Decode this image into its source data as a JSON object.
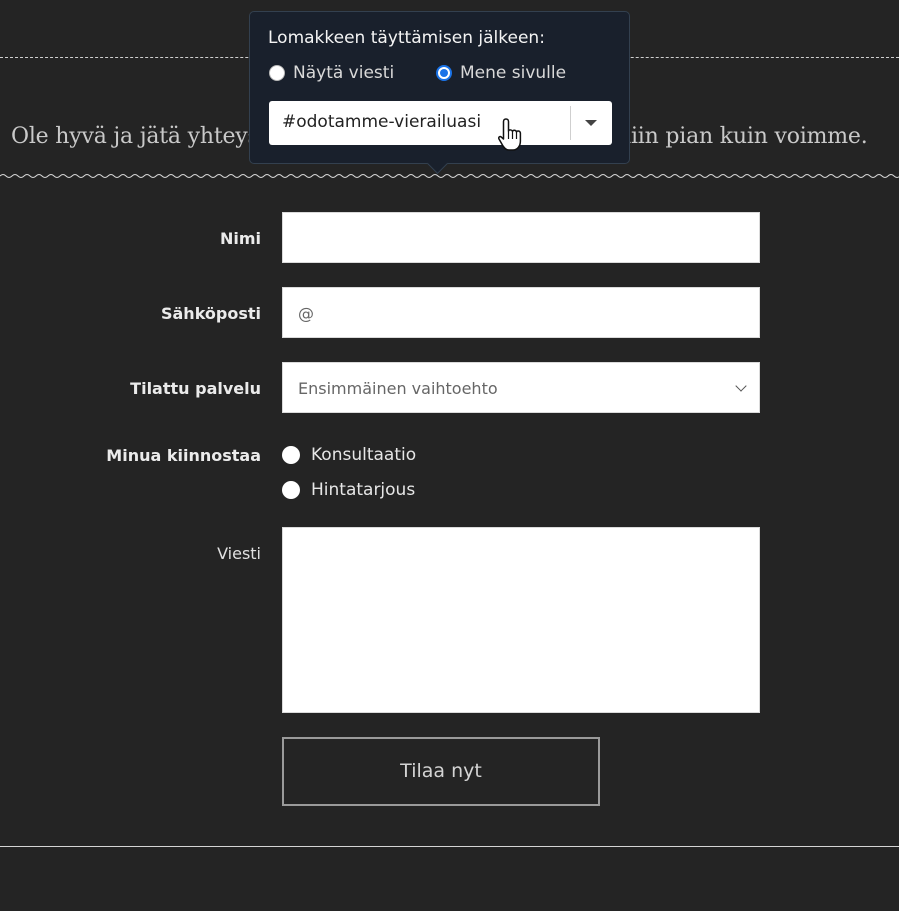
{
  "intro": {
    "text_left": "Ole hyvä ja jätä yhteyst",
    "text_right": "niin pian kuin voimme."
  },
  "popover": {
    "title": "Lomakkeen täyttämisen jälkeen:",
    "options": [
      {
        "label": "Näytä viesti",
        "checked": false
      },
      {
        "label": "Mene sivulle",
        "checked": true
      }
    ],
    "page_select_value": "#odotamme-vierailuasi"
  },
  "form": {
    "name_label": "Nimi",
    "name_value": "",
    "email_label": "Sähköposti",
    "email_placeholder": "@",
    "service_label": "Tilattu palvelu",
    "service_value": "Ensimmäinen vaihtoehto",
    "interest_label": "Minua kiinnostaa",
    "interest_options": [
      "Konsultaatio",
      "Hintatarjous"
    ],
    "message_label": "Viesti",
    "submit_label": "Tilaa nyt"
  },
  "colors": {
    "background": "#242424",
    "popover_bg": "#19202c",
    "radio_accent": "#1a73e8"
  }
}
